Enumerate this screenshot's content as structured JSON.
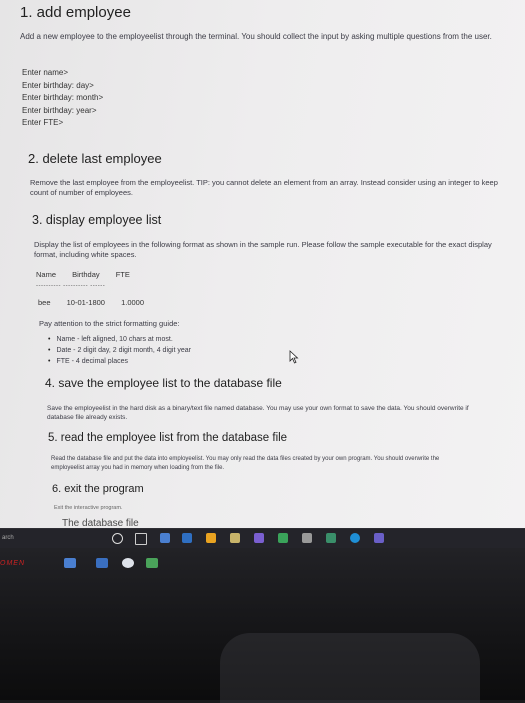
{
  "sections": [
    {
      "title": "1. add employee",
      "description": "Add a new employee to the employeelist through the terminal. You should collect the input by asking multiple questions from the user."
    },
    {
      "title": "2. delete last employee",
      "description": "Remove the last employee from the employeelist. TIP: you cannot delete an element from an array. Instead consider using an integer to keep count of number of employees."
    },
    {
      "title": "3. display employee list",
      "description": "Display the list of employees in the following format as shown in the sample run. Please follow the sample executable for the exact display format, including white spaces."
    },
    {
      "title": "4. save the employee list to the database file",
      "description": "Save the employeelist in the hard disk as a binary/text file named database. You may use your own format to save the data. You should overwrite if database file already exists."
    },
    {
      "title": "5. read the employee list from the database file",
      "description": "Read the database file and put the data into employeelist. You may only read the data files created by your own program. You should overwrite the employeelist array you had in memory when loading from the file."
    },
    {
      "title": "6. exit the program",
      "description": "Exit the interactive program."
    }
  ],
  "prompts": [
    "Enter name>",
    "Enter birthday: day>",
    "Enter birthday: month>",
    "Enter birthday: year>",
    "Enter FTE>"
  ],
  "display_format": {
    "headers": [
      "Name",
      "Birthday",
      "FTE"
    ],
    "separator": "---------- ---------- ------",
    "sample": [
      "bee",
      "10-01-1800",
      "1.0000"
    ],
    "rules_title": "Pay attention to the strict formatting guide:",
    "rules": [
      "Name - left aligned, 10 chars at most.",
      "Date - 2 digit day, 2 digit month, 4 digit year",
      "FTE - 4 decimal places"
    ]
  },
  "cut_text": "The database file",
  "taskbar": {
    "search_label": "arch"
  },
  "monitor": {
    "brand": "OMEN"
  },
  "colors": {
    "page_bg": "#ededee",
    "taskbar_bg": "#24242a",
    "heading": "#222222",
    "body": "#3c3c46"
  }
}
